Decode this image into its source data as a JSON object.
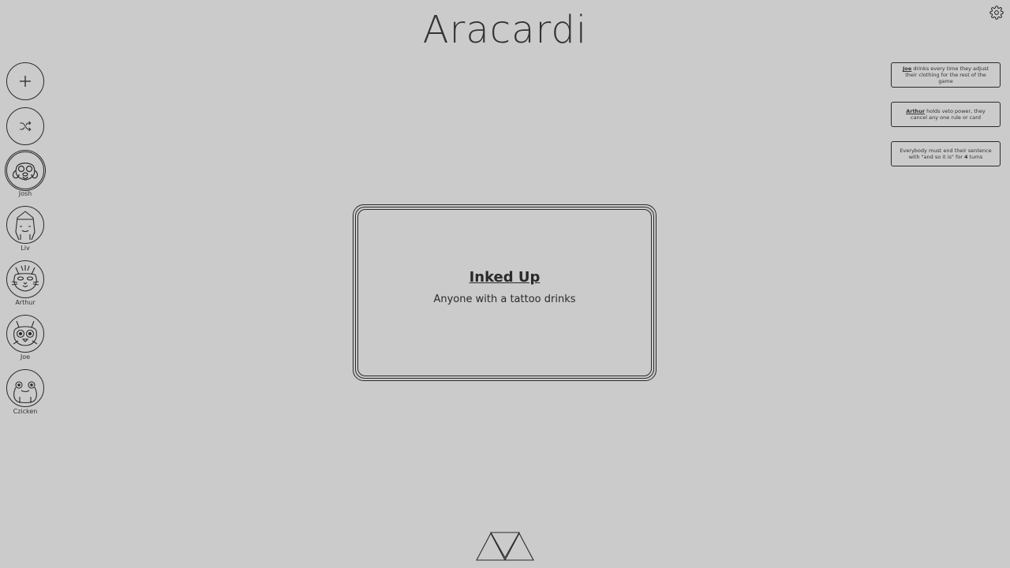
{
  "app": {
    "title": "Aracardi"
  },
  "icons": {
    "settings": "gear-icon",
    "add": "plus-icon",
    "shuffle": "shuffle-icon",
    "logo": "triangles-logo-icon"
  },
  "players": [
    {
      "name": "Josh",
      "avatar": "dog-avatar-icon",
      "active": true
    },
    {
      "name": "Liv",
      "avatar": "gnome-avatar-icon",
      "active": false
    },
    {
      "name": "Arthur",
      "avatar": "cat-avatar-icon",
      "active": false
    },
    {
      "name": "Joe",
      "avatar": "raccoon-avatar-icon",
      "active": false
    },
    {
      "name": "Czicken",
      "avatar": "frog-avatar-icon",
      "active": false
    }
  ],
  "rules": [
    {
      "name": "Joe",
      "text": " drinks every time they adjust their clothing for the rest of the game"
    },
    {
      "name": "Arthur",
      "text": " holds veto power, they cancel any one rule or card"
    },
    {
      "text_before": "Everybody must end their sentence with \"and so it is\" for ",
      "count": "4",
      "text_after": " turns"
    }
  ],
  "card": {
    "title": "Inked Up",
    "text": "Anyone with a tattoo drinks"
  },
  "colors": {
    "background": "#cbcbcb",
    "ink": "#2a2a2a"
  }
}
